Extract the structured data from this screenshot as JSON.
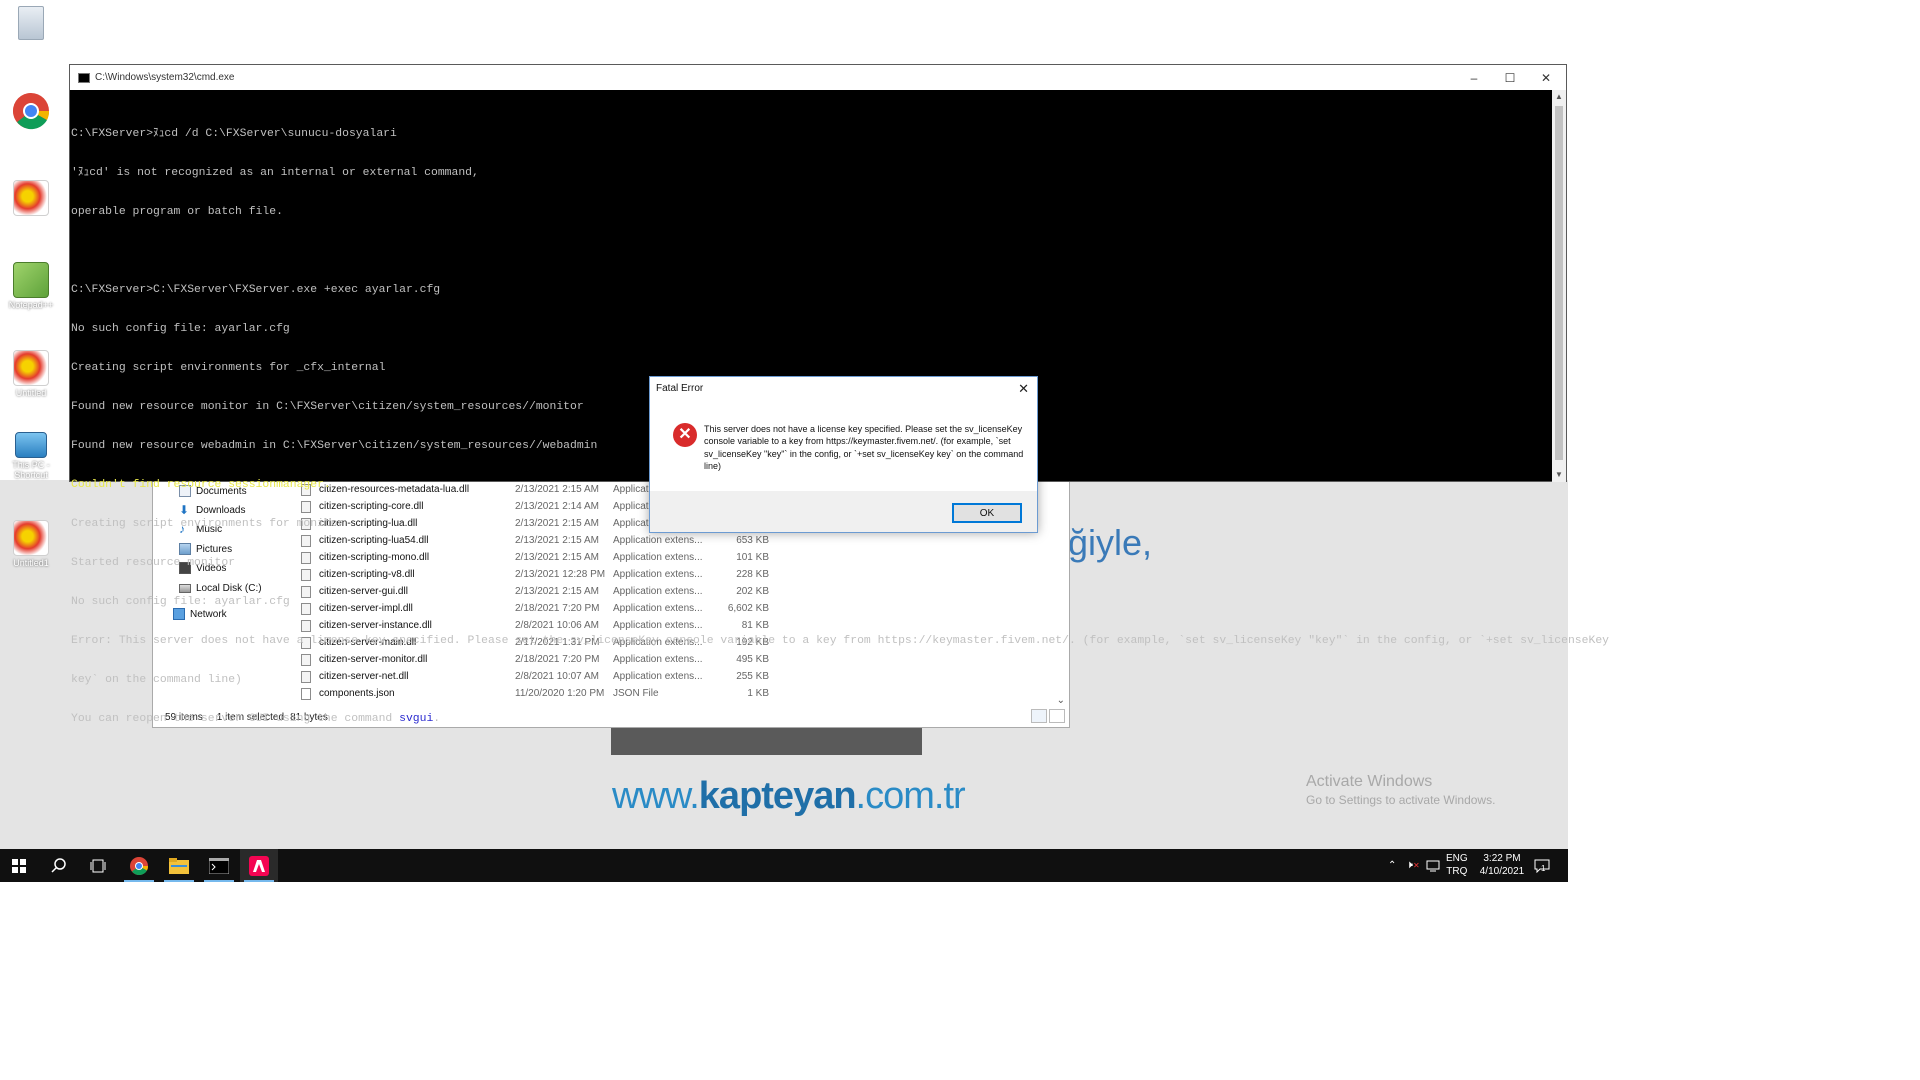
{
  "desktop": {
    "icons": [
      {
        "name": "recycle-bin",
        "label": ""
      },
      {
        "name": "google-chrome",
        "label": ""
      },
      {
        "name": "paint-shortcut-1",
        "label": ""
      },
      {
        "name": "notepad-plus-plus",
        "label": "Notepad++"
      },
      {
        "name": "paint-untitled",
        "label": "Untitled"
      },
      {
        "name": "this-pc",
        "label": "This PC - Shortcut"
      },
      {
        "name": "paint-untitled1",
        "label": "Untitled1"
      }
    ],
    "site_text_partial": "ğiyle,",
    "site_url_pre": "www.",
    "site_url_brand": "kapteyan",
    "site_url_post": ".com.tr",
    "activate_title": "Activate Windows",
    "activate_sub": "Go to Settings to activate Windows."
  },
  "cmd": {
    "title": "C:\\Windows\\system32\\cmd.exe",
    "lines": [
      {
        "text": "C:\\FXServer>ﾇｭcd /d C:\\FXServer\\sunucu-dosyalari",
        "style": ""
      },
      {
        "text": "'ﾇｭcd' is not recognized as an internal or external command,",
        "style": ""
      },
      {
        "text": "operable program or batch file.",
        "style": ""
      },
      {
        "text": "",
        "style": ""
      },
      {
        "text": "C:\\FXServer>C:\\FXServer\\FXServer.exe +exec ayarlar.cfg",
        "style": ""
      },
      {
        "text": "No such config file: ayarlar.cfg",
        "style": ""
      },
      {
        "text": "Creating script environments for _cfx_internal",
        "style": ""
      },
      {
        "text": "Found new resource monitor in C:\\FXServer\\citizen/system_resources//monitor",
        "style": ""
      },
      {
        "text": "Found new resource webadmin in C:\\FXServer\\citizen/system_resources//webadmin",
        "style": ""
      },
      {
        "text": "Couldn't find resource sessionmanager.",
        "style": "yellow"
      },
      {
        "text": "Creating script environments for monitor",
        "style": ""
      },
      {
        "text": "Started resource monitor",
        "style": ""
      },
      {
        "text": "No such config file: ayarlar.cfg",
        "style": ""
      },
      {
        "text": "Error: This server does not have a license key specified. Please set the sv_licenseKey console variable to a key from https://keymaster.fivem.net/. (for example, `set sv_licenseKey \"key\"` in the config, or `+set sv_licenseKey",
        "style": ""
      },
      {
        "text": "key` on the command line)",
        "style": ""
      }
    ],
    "gui_line_pre": "You can reopen the server GUI using the command ",
    "gui_line_cmd": "svgui",
    "gui_line_post": "."
  },
  "explorer": {
    "nav": [
      {
        "label": "Documents",
        "icon": "documents-icon"
      },
      {
        "label": "Downloads",
        "icon": "downloads-icon"
      },
      {
        "label": "Music",
        "icon": "music-icon"
      },
      {
        "label": "Pictures",
        "icon": "pictures-icon"
      },
      {
        "label": "Videos",
        "icon": "videos-icon"
      },
      {
        "label": "Local Disk (C:)",
        "icon": "disk-icon"
      },
      {
        "label": "Network",
        "icon": "network-icon"
      }
    ],
    "files": [
      {
        "name": "citizen-resources-metadata-lua.dll",
        "date": "2/13/2021 2:15 AM",
        "type": "Applicatio",
        "size": ""
      },
      {
        "name": "citizen-scripting-core.dll",
        "date": "2/13/2021 2:14 AM",
        "type": "Applicatio",
        "size": ""
      },
      {
        "name": "citizen-scripting-lua.dll",
        "date": "2/13/2021 2:15 AM",
        "type": "Applicatio",
        "size": ""
      },
      {
        "name": "citizen-scripting-lua54.dll",
        "date": "2/13/2021 2:15 AM",
        "type": "Application extens...",
        "size": "653 KB"
      },
      {
        "name": "citizen-scripting-mono.dll",
        "date": "2/13/2021 2:15 AM",
        "type": "Application extens...",
        "size": "101 KB"
      },
      {
        "name": "citizen-scripting-v8.dll",
        "date": "2/13/2021 12:28 PM",
        "type": "Application extens...",
        "size": "228 KB"
      },
      {
        "name": "citizen-server-gui.dll",
        "date": "2/13/2021 2:15 AM",
        "type": "Application extens...",
        "size": "202 KB"
      },
      {
        "name": "citizen-server-impl.dll",
        "date": "2/18/2021 7:20 PM",
        "type": "Application extens...",
        "size": "6,602 KB"
      },
      {
        "name": "citizen-server-instance.dll",
        "date": "2/8/2021 10:06 AM",
        "type": "Application extens...",
        "size": "81 KB"
      },
      {
        "name": "citizen-server-main.dll",
        "date": "2/17/2021 1:31 PM",
        "type": "Application extens...",
        "size": "192 KB"
      },
      {
        "name": "citizen-server-monitor.dll",
        "date": "2/18/2021 7:20 PM",
        "type": "Application extens...",
        "size": "495 KB"
      },
      {
        "name": "citizen-server-net.dll",
        "date": "2/8/2021 10:07 AM",
        "type": "Application extens...",
        "size": "255 KB"
      },
      {
        "name": "components.json",
        "date": "11/20/2020 1:20 PM",
        "type": "JSON File",
        "size": "1 KB"
      }
    ],
    "status_items": "59 items",
    "status_selected": "1 item selected",
    "status_bytes": "81 bytes"
  },
  "dialog": {
    "title": "Fatal Error",
    "message": "This server does not have a license key specified. Please set the sv_licenseKey console variable to a key from https://keymaster.fivem.net/. (for example, `set sv_licenseKey \"key\"` in the config, or `+set sv_licenseKey key` on the command line)",
    "ok_label": "OK"
  },
  "taskbar": {
    "apps": [
      "start-icon",
      "search-icon",
      "task-view-icon",
      "chrome-icon",
      "file-explorer-icon",
      "cmd-icon",
      "fivem-icon"
    ],
    "lang_top": "ENG",
    "lang_bottom": "TRQ",
    "time": "3:22 PM",
    "date": "4/10/2021",
    "notification_count": "1"
  }
}
